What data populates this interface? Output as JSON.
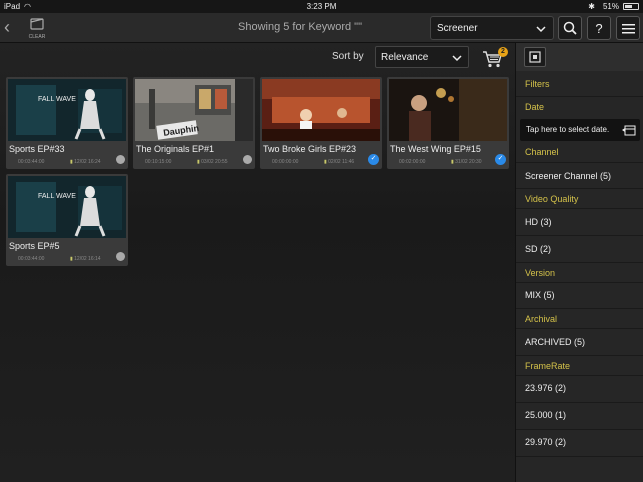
{
  "status_bar": {
    "carrier": "iPad",
    "time": "3:23 PM",
    "battery": "51%"
  },
  "header": {
    "logo_label": "CLEAR",
    "title": "Showing 5 for Keyword \"\"",
    "screener_value": "Screener"
  },
  "toolbar": {
    "sort_label": "Sort by",
    "sort_value": "Relevance",
    "cart_count": "2"
  },
  "cards": [
    {
      "title": "Sports EP#33",
      "duration": "00:03:44:00",
      "date": "12/02 16:24",
      "selected": false
    },
    {
      "title": "The Originals EP#1",
      "duration": "00:10:15:00",
      "date": "03/02 20:55",
      "selected": false
    },
    {
      "title": "Two Broke Girls EP#23",
      "duration": "00:00:00:00",
      "date": "02/02 11:46",
      "selected": true
    },
    {
      "title": "The West Wing EP#15",
      "duration": "00:02:00:00",
      "date": "31/02 20:30",
      "selected": true
    },
    {
      "title": "Sports EP#5",
      "duration": "00:03:44:00",
      "date": "12/02 16:14",
      "selected": false
    }
  ],
  "thumb_text": {
    "card1": "FALL WAVE",
    "card2": "Dauphin"
  },
  "filters": {
    "heading": "Filters",
    "date_header": "Date",
    "date_placeholder": "Tap here to select date.",
    "channel_header": "Channel",
    "channel_opt": "Screener Channel (5)",
    "video_quality_header": "Video Quality",
    "hd_opt": "HD (3)",
    "sd_opt": "SD (2)",
    "version_header": "Version",
    "mix_opt": "MIX (5)",
    "archival_header": "Archival",
    "archived_opt": "ARCHIVED (5)",
    "framerate_header": "FrameRate",
    "fr1_opt": "23.976 (2)",
    "fr2_opt": "25.000 (1)",
    "fr3_opt": "29.970 (2)"
  },
  "colors": {
    "accent": "#d4c24a",
    "select_blue": "#2a8ae8",
    "cart_badge": "#e8a317"
  }
}
